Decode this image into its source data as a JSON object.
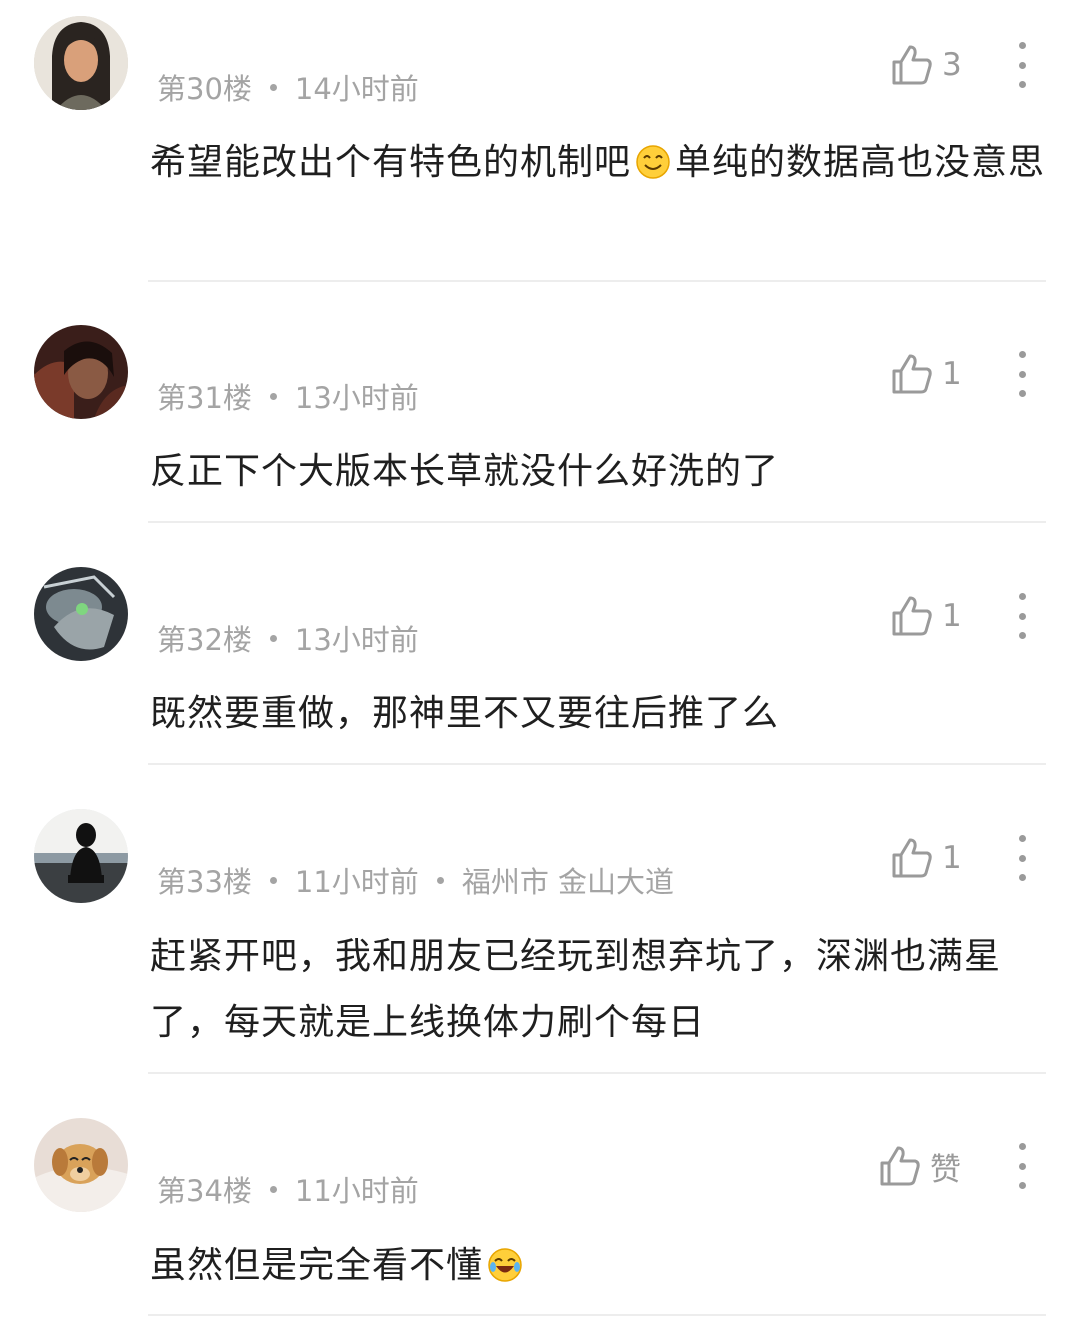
{
  "comments": [
    {
      "floor": "第30楼",
      "time": "14小时前",
      "location": "",
      "likes": "3",
      "text_before": "希望能改出个有特色的机制吧",
      "emoji": "smile-emoji",
      "text_after": "单纯的数据高也没意思"
    },
    {
      "floor": "第31楼",
      "time": "13小时前",
      "location": "",
      "likes": "1",
      "text_before": "反正下个大版本长草就没什么好洗的了"
    },
    {
      "floor": "第32楼",
      "time": "13小时前",
      "location": "",
      "likes": "1",
      "text_before": "既然要重做，那神里不又要往后推了么"
    },
    {
      "floor": "第33楼",
      "time": "11小时前",
      "location": "福州市 金山大道",
      "likes": "1",
      "text_before": "赶紧开吧，我和朋友已经玩到想弃坑了，深渊也满星了，每天就是上线换体力刷个每日"
    },
    {
      "floor": "第34楼",
      "time": "11小时前",
      "location": "",
      "likes": "赞",
      "text_before": "虽然但是完全看不懂",
      "emoji": "laugh-cry-emoji"
    }
  ],
  "colors": {
    "meta_gray": "#a4a4a4",
    "icon_gray": "#9a9a9a",
    "text": "#1f1f1f",
    "divider": "#ededed"
  }
}
